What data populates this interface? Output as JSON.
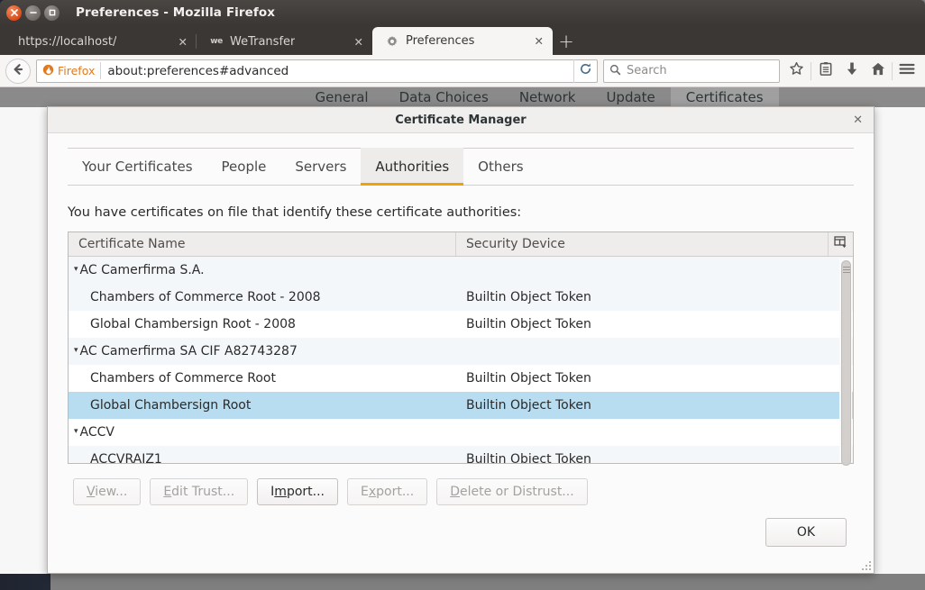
{
  "window": {
    "title": "Preferences - Mozilla Firefox",
    "close_label": "✕",
    "minimize_label": "–",
    "maximize_label": "□"
  },
  "tabs": [
    {
      "label": "https://localhost/",
      "close": "✕",
      "favicon": "none",
      "active": false
    },
    {
      "label": "WeTransfer",
      "close": "✕",
      "favicon": "we-icon",
      "active": false
    },
    {
      "label": "Preferences",
      "close": "✕",
      "favicon": "gear-icon",
      "active": true
    }
  ],
  "newtab_label": "+",
  "navbar": {
    "back_icon": "back-arrow-icon",
    "identity_label": "Firefox",
    "identity_icon": "firefox-icon",
    "url": "about:preferences#advanced",
    "reload_icon": "reload-icon",
    "search_placeholder": "Search",
    "search_icon": "search-icon",
    "icons": [
      "bookmark-star-icon",
      "library-icon",
      "downloads-icon",
      "home-icon",
      "menu-icon"
    ]
  },
  "prefs_tabs": [
    {
      "label": "General",
      "selected": false
    },
    {
      "label": "Data Choices",
      "selected": false
    },
    {
      "label": "Network",
      "selected": false
    },
    {
      "label": "Update",
      "selected": false
    },
    {
      "label": "Certificates",
      "selected": true
    }
  ],
  "launcher": {
    "items": [
      {
        "icon": "ubuntu-dash-icon",
        "active": false
      },
      {
        "icon": "search-files-icon",
        "active": false
      },
      {
        "icon": "document-icon",
        "active": false
      },
      {
        "icon": "rocket-icon",
        "active": false
      },
      {
        "icon": "mask-icon",
        "active": false
      },
      {
        "icon": "basket-icon",
        "active": false
      },
      {
        "icon": "sync-icon",
        "active": false
      },
      {
        "icon": "firefox-flame-icon",
        "active": true
      }
    ]
  },
  "dialog": {
    "title": "Certificate Manager",
    "close_label": "✕",
    "tabs": [
      {
        "label": "Your Certificates",
        "active": false
      },
      {
        "label": "People",
        "active": false
      },
      {
        "label": "Servers",
        "active": false
      },
      {
        "label": "Authorities",
        "active": true
      },
      {
        "label": "Others",
        "active": false
      }
    ],
    "intro": "You have certificates on file that identify these certificate authorities:",
    "columns": {
      "name": "Certificate Name",
      "device": "Security Device",
      "picker_icon": "column-picker-icon"
    },
    "rows": [
      {
        "name": "AC Camerfirma S.A.",
        "device": "",
        "group": true,
        "twisty": "▾",
        "stripe": "odd",
        "selected": false
      },
      {
        "name": "Chambers of Commerce Root - 2008",
        "device": "Builtin Object Token",
        "group": false,
        "stripe": "odd",
        "selected": false
      },
      {
        "name": "Global Chambersign Root - 2008",
        "device": "Builtin Object Token",
        "group": false,
        "stripe": "even",
        "selected": false
      },
      {
        "name": "AC Camerfirma SA CIF A82743287",
        "device": "",
        "group": true,
        "twisty": "▾",
        "stripe": "odd",
        "selected": false
      },
      {
        "name": "Chambers of Commerce Root",
        "device": "Builtin Object Token",
        "group": false,
        "stripe": "even",
        "selected": false
      },
      {
        "name": "Global Chambersign Root",
        "device": "Builtin Object Token",
        "group": false,
        "stripe": "even",
        "selected": true
      },
      {
        "name": "ACCV",
        "device": "",
        "group": true,
        "twisty": "▾",
        "stripe": "even",
        "selected": false
      },
      {
        "name": "ACCVRAIZ1",
        "device": "Builtin Object Token",
        "group": false,
        "stripe": "odd",
        "selected": false
      }
    ],
    "buttons": [
      {
        "prefix": "",
        "mnemonic": "V",
        "suffix": "iew...",
        "disabled": true
      },
      {
        "prefix": "",
        "mnemonic": "E",
        "suffix": "dit Trust...",
        "disabled": true
      },
      {
        "prefix": "I",
        "mnemonic": "m",
        "suffix": "port...",
        "disabled": false
      },
      {
        "prefix": "E",
        "mnemonic": "x",
        "suffix": "port...",
        "disabled": true
      },
      {
        "prefix": "",
        "mnemonic": "D",
        "suffix": "elete or Distrust...",
        "disabled": true
      }
    ],
    "ok_label": "OK"
  },
  "colors": {
    "accent_orange": "#f0a202",
    "firefox_orange": "#e07a1f",
    "selection_blue": "#b8ddf0",
    "stripe": "#f4f7fa",
    "titlebar": "#3b3735",
    "launcher": "#232836"
  }
}
